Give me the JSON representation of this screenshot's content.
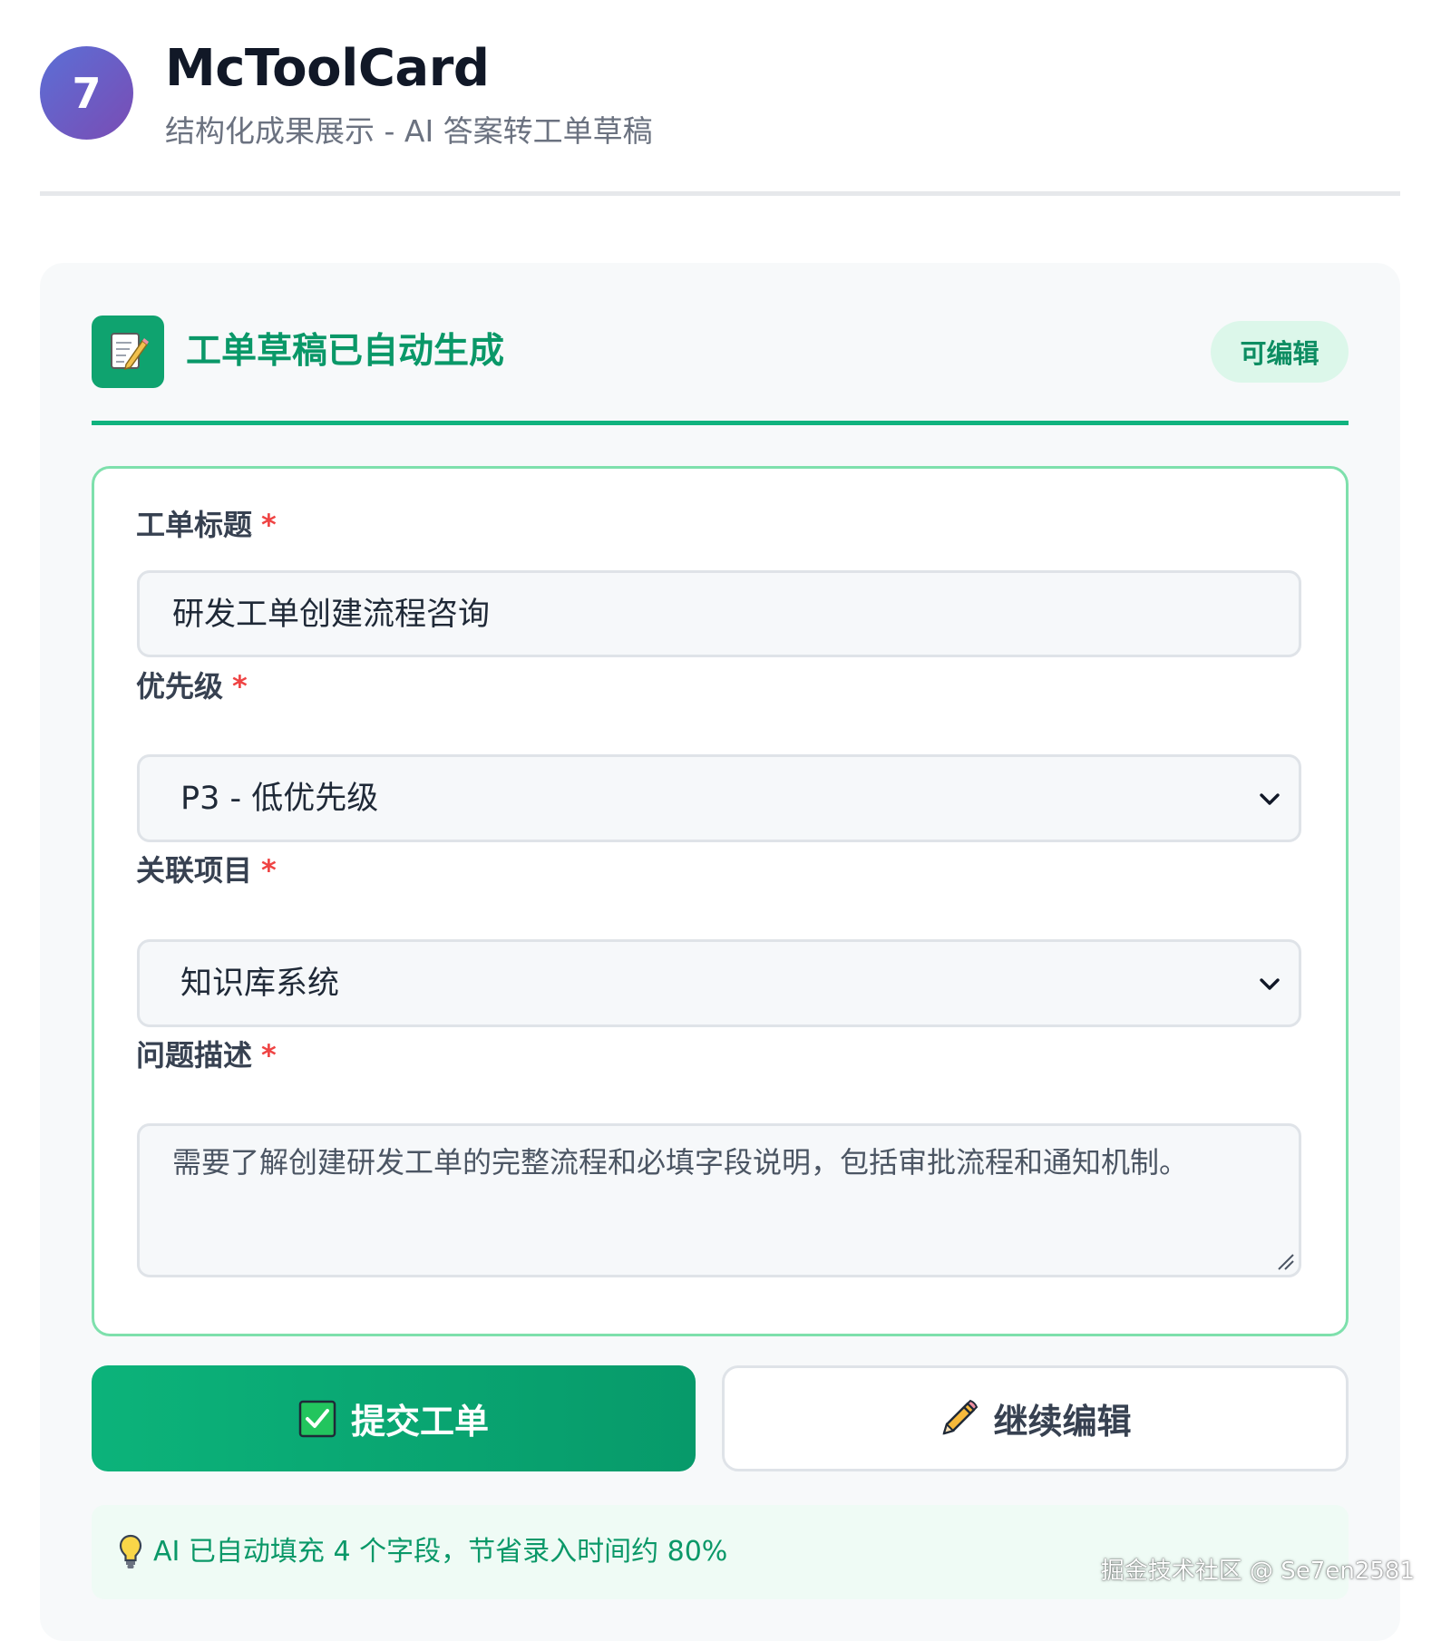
{
  "header": {
    "step_number": "7",
    "title": "McToolCard",
    "subtitle": "结构化成果展示 - AI 答案转工单草稿"
  },
  "card": {
    "icon": "memo-icon",
    "title": "工单草稿已自动生成",
    "badge": "可编辑"
  },
  "form": {
    "required_mark": "*",
    "fields": [
      {
        "label": "工单标题",
        "value": "研发工单创建流程咨询",
        "type": "text"
      },
      {
        "label": "优先级",
        "value": "P3 - 低优先级",
        "type": "select"
      },
      {
        "label": "关联项目",
        "value": "知识库系统",
        "type": "select"
      },
      {
        "label": "问题描述",
        "value": "需要了解创建研发工单的完整流程和必填字段说明，包括审批流程和通知机制。",
        "type": "textarea"
      }
    ]
  },
  "actions": {
    "submit_label": "提交工单",
    "submit_icon": "check-box-icon",
    "edit_label": "继续编辑",
    "edit_icon": "pencil-icon"
  },
  "hint": {
    "icon": "lightbulb-icon",
    "text": "AI 已自动填充 4 个字段，节省录入时间约 80%"
  },
  "watermark": "掘金技术社区 @ Se7en2581",
  "colors": {
    "accent": "#10b37e",
    "badge_bg": "#dcf7ea",
    "form_border": "#7ee0ac",
    "required": "#ef4444",
    "step_badge_start": "#5b6fd6",
    "step_badge_end": "#7a4cb4"
  }
}
